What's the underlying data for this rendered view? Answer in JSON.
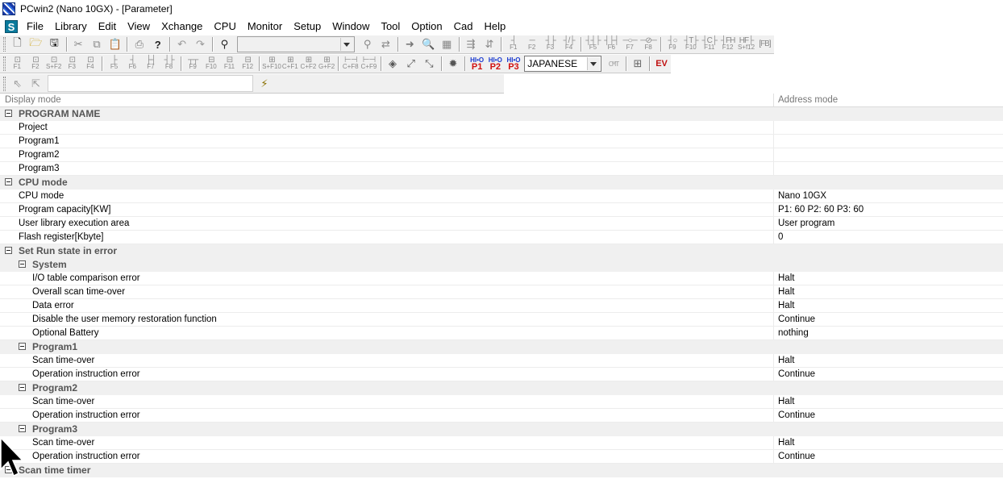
{
  "window": {
    "title": "PCwin2 (Nano 10GX)  - [Parameter]"
  },
  "menu": {
    "logo": "S",
    "items": [
      "File",
      "Library",
      "Edit",
      "View",
      "Xchange",
      "CPU",
      "Monitor",
      "Setup",
      "Window",
      "Tool",
      "Option",
      "Cad",
      "Help"
    ]
  },
  "toolbar2": {
    "language": "JAPANESE",
    "p_buttons": [
      {
        "top": "HI•O",
        "label": "P1"
      },
      {
        "top": "HI•O",
        "label": "P2"
      },
      {
        "top": "HI•O",
        "label": "P3"
      }
    ],
    "cmt_label": "CMT",
    "ev_label": "EV"
  },
  "grid": {
    "header": {
      "left": "Display mode",
      "right": "Address mode"
    },
    "rows": [
      {
        "label": "PROGRAM NAME",
        "value": "",
        "group": true,
        "level": 0
      },
      {
        "label": "Project",
        "value": "",
        "group": false,
        "level": 0
      },
      {
        "label": "Program1",
        "value": "",
        "group": false,
        "level": 0
      },
      {
        "label": "Program2",
        "value": "",
        "group": false,
        "level": 0
      },
      {
        "label": "Program3",
        "value": "",
        "group": false,
        "level": 0
      },
      {
        "label": "CPU mode",
        "value": "",
        "group": true,
        "level": 0
      },
      {
        "label": "CPU mode",
        "value": "Nano 10GX",
        "group": false,
        "level": 0
      },
      {
        "label": "Program capacity[KW]",
        "value": "P1: 60 P2: 60 P3: 60",
        "group": false,
        "level": 0
      },
      {
        "label": "User library execution area",
        "value": "User program",
        "group": false,
        "level": 0
      },
      {
        "label": "Flash register[Kbyte]",
        "value": "0",
        "group": false,
        "level": 0
      },
      {
        "label": "Set Run state in error",
        "value": "",
        "group": true,
        "level": 0
      },
      {
        "label": "System",
        "value": "",
        "group": true,
        "level": 1
      },
      {
        "label": "I/O table comparison error",
        "value": "Halt",
        "group": false,
        "level": 1
      },
      {
        "label": "Overall scan time-over",
        "value": "Halt",
        "group": false,
        "level": 1
      },
      {
        "label": "Data error",
        "value": "Halt",
        "group": false,
        "level": 1
      },
      {
        "label": "Disable the user memory restoration function",
        "value": "Continue",
        "group": false,
        "level": 1
      },
      {
        "label": "Optional Battery",
        "value": "nothing",
        "group": false,
        "level": 1
      },
      {
        "label": "Program1",
        "value": "",
        "group": true,
        "level": 1
      },
      {
        "label": "Scan time-over",
        "value": "Halt",
        "group": false,
        "level": 1
      },
      {
        "label": "Operation instruction error",
        "value": "Continue",
        "group": false,
        "level": 1
      },
      {
        "label": "Program2",
        "value": "",
        "group": true,
        "level": 1
      },
      {
        "label": "Scan time-over",
        "value": "Halt",
        "group": false,
        "level": 1
      },
      {
        "label": "Operation instruction error",
        "value": "Continue",
        "group": false,
        "level": 1
      },
      {
        "label": "Program3",
        "value": "",
        "group": true,
        "level": 1
      },
      {
        "label": "Scan time-over",
        "value": "Halt",
        "group": false,
        "level": 1
      },
      {
        "label": "Operation instruction error",
        "value": "Continue",
        "group": false,
        "level": 1
      },
      {
        "label": "Scan time timer",
        "value": "",
        "group": true,
        "level": 0
      }
    ]
  }
}
